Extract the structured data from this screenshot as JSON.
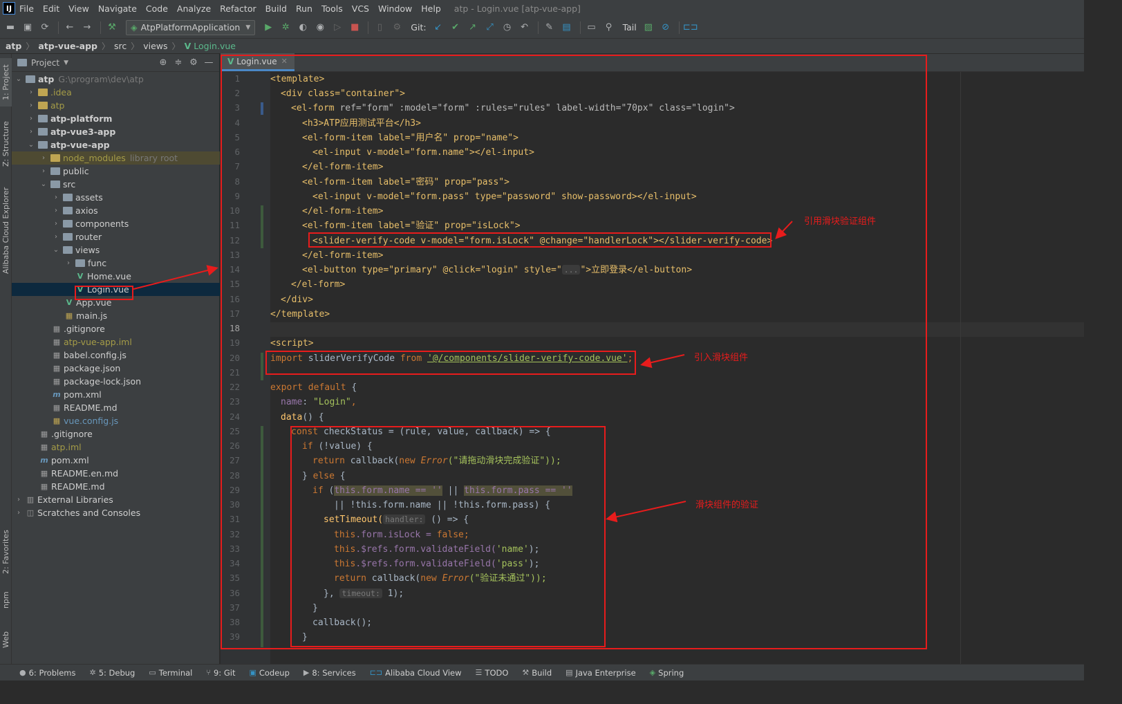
{
  "menu": {
    "app_icon": "IJ",
    "items": [
      "File",
      "Edit",
      "View",
      "Navigate",
      "Code",
      "Analyze",
      "Refactor",
      "Build",
      "Run",
      "Tools",
      "VCS",
      "Window",
      "Help"
    ],
    "window_title": "atp - Login.vue [atp-vue-app]"
  },
  "toolbar": {
    "run_config": "AtpPlatformApplication",
    "git_label": "Git:",
    "tail_label": "Tail"
  },
  "breadcrumb": [
    "atp",
    "atp-vue-app",
    "src",
    "views",
    "Login.vue"
  ],
  "side_tabs": {
    "project": "1: Project",
    "structure": "Z: Structure",
    "alibaba": "Alibaba Cloud Explorer",
    "favorites": "2: Favorites",
    "npm": "npm",
    "web": "Web"
  },
  "project_panel": {
    "title": "Project",
    "tree": [
      {
        "label": "atp",
        "extra": "G:\\program\\dev\\atp"
      },
      {
        "label": ".idea"
      },
      {
        "label": "atp"
      },
      {
        "label": "atp-platform"
      },
      {
        "label": "atp-vue3-app"
      },
      {
        "label": "atp-vue-app"
      },
      {
        "label": "node_modules",
        "extra": "library root"
      },
      {
        "label": "public"
      },
      {
        "label": "src"
      },
      {
        "label": "assets"
      },
      {
        "label": "axios"
      },
      {
        "label": "components"
      },
      {
        "label": "router"
      },
      {
        "label": "views"
      },
      {
        "label": "func"
      },
      {
        "label": "Home.vue"
      },
      {
        "label": "Login.vue"
      },
      {
        "label": "App.vue"
      },
      {
        "label": "main.js"
      },
      {
        "label": ".gitignore"
      },
      {
        "label": "atp-vue-app.iml"
      },
      {
        "label": "babel.config.js"
      },
      {
        "label": "package.json"
      },
      {
        "label": "package-lock.json"
      },
      {
        "label": "pom.xml"
      },
      {
        "label": "README.md"
      },
      {
        "label": "vue.config.js"
      },
      {
        "label": ".gitignore"
      },
      {
        "label": "atp.iml"
      },
      {
        "label": "pom.xml"
      },
      {
        "label": "README.en.md"
      },
      {
        "label": "README.md"
      },
      {
        "label": "External Libraries"
      },
      {
        "label": "Scratches and Consoles"
      }
    ]
  },
  "editor": {
    "tab": "Login.vue",
    "line_numbers": [
      "1",
      "2",
      "3",
      "4",
      "5",
      "6",
      "7",
      "8",
      "9",
      "10",
      "11",
      "12",
      "13",
      "14",
      "15",
      "16",
      "17",
      "18",
      "19",
      "20",
      "21",
      "22",
      "23",
      "24",
      "25",
      "26",
      "27",
      "28",
      "29",
      "30",
      "31",
      "32",
      "33",
      "34",
      "35",
      "36",
      "37",
      "38",
      "39"
    ],
    "code": {
      "l1": "<template>",
      "l2": "<div class=\"container\">",
      "l3a": "<el-form ",
      "l3b": "ref=\"form\" :model=\"form\" :rules=\"rules\" label-width=\"70px\" class=\"login\">",
      "l4": "<h3>ATP应用测试平台</h3>",
      "l5": "<el-form-item label=\"用户名\" prop=\"name\">",
      "l6": "<el-input v-model=\"form.name\"></el-input>",
      "l7": "</el-form-item>",
      "l8": "<el-form-item label=\"密码\" prop=\"pass\">",
      "l9": "<el-input v-model=\"form.pass\" type=\"password\" show-password></el-input>",
      "l10": "</el-form-item>",
      "l11": "<el-form-item label=\"验证\" prop=\"isLock\">",
      "l12": "<slider-verify-code v-model=\"form.isLock\" @change=\"handlerLock\"></slider-verify-code>",
      "l13": "</el-form-item>",
      "l14a": "<el-button type=\"primary\" @click=\"login\" style=\"",
      "l14b": "...",
      "l14c": "\">立即登录</el-button>",
      "l15": "</el-form>",
      "l16": "</div>",
      "l17": "</template>",
      "l19": "<script>",
      "l20a": "import ",
      "l20b": "sliderVerifyCode ",
      "l20c": "from ",
      "l20d": "'@/components/slider-verify-code.vue'",
      "l20e": ";",
      "l22a": "export default ",
      "l22b": "{",
      "l23a": "name",
      "l23b": ": ",
      "l23c": "\"Login\"",
      "l23d": ",",
      "l24a": "data",
      "l24b": "() {",
      "l25a": "const ",
      "l25b": "checkStatus = (rule, value, callback) => {",
      "l26a": "if ",
      "l26b": "(!value) {",
      "l27a": "return ",
      "l27b": "callback(",
      "l27c": "new ",
      "l27d": "Error",
      "l27e": "(\"请拖动滑块完成验证\"));",
      "l28a": "} ",
      "l28b": "else ",
      "l28c": "{",
      "l29a": "if ",
      "l29b": "(",
      "l29c": "this.form.name == ''",
      "l29d": " || ",
      "l29e": "this.form.pass == ''",
      "l30": "|| !this.form.name || !this.form.pass) {",
      "l31a": "setTimeout(",
      "l31b": "handler:",
      "l31c": " () => {",
      "l32a": "this",
      "l32b": ".form.isLock = ",
      "l32c": "false",
      "l32d": ";",
      "l33a": "this",
      "l33b": ".$refs.form.validateField(",
      "l33c": "'name'",
      "l33d": ");",
      "l34a": "this",
      "l34b": ".$refs.form.validateField(",
      "l34c": "'pass'",
      "l34d": ");",
      "l35a": "return ",
      "l35b": "callback(",
      "l35c": "new ",
      "l35d": "Error",
      "l35e": "(\"验证未通过\"));",
      "l36a": "}, ",
      "l36b": "timeout:",
      "l36c": " 1);",
      "l37": "}",
      "l38": "callback();",
      "l39": "}"
    }
  },
  "annotations": {
    "note1": "引用滑块验证组件",
    "note2": "引入滑块组件",
    "note3": "滑块组件的验证",
    "color": "#e81c1c"
  },
  "statusbar": [
    "6: Problems",
    "5: Debug",
    "Terminal",
    "9: Git",
    "Codeup",
    "8: Services",
    "Alibaba Cloud View",
    "TODO",
    "Build",
    "Java Enterprise",
    "Spring"
  ]
}
